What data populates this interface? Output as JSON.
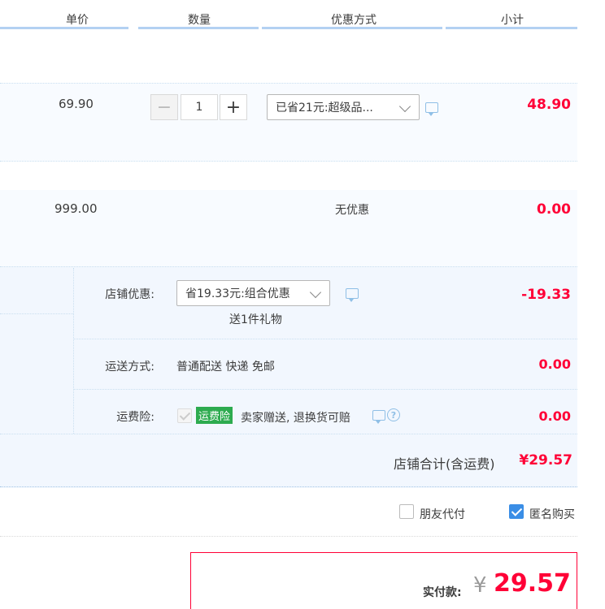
{
  "header": {
    "col_price": "单价",
    "col_qty": "数量",
    "col_promo": "优惠方式",
    "col_subtotal": "小计"
  },
  "item1": {
    "price": "69.90",
    "qty": "1",
    "promo_selected": "已省21元:超级品...",
    "subtotal": "48.90"
  },
  "item2": {
    "price": "999.00",
    "promo": "无优惠",
    "subtotal": "0.00"
  },
  "shop": {
    "discount_label": "店铺优惠:",
    "discount_selected": "省19.33元:组合优惠",
    "gift": "送1件礼物",
    "discount_value": "-19.33",
    "shipping_label": "运送方式:",
    "shipping_value": "普通配送 快递 免邮",
    "shipping_cost": "0.00",
    "insurance_label": "运费险:",
    "insurance_tag": "运费险",
    "insurance_text": "卖家赠送, 退换货可赔",
    "insurance_cost": "0.00",
    "total_label": "店铺合计(含运费)",
    "total_value": "¥29.57"
  },
  "options": {
    "friend_pay": "朋友代付",
    "anonymous": "匿名购买"
  },
  "payment": {
    "label": "实付款:",
    "currency": "¥",
    "amount": "29.57"
  },
  "colors": {
    "accent_red": "#ff0036",
    "row_bg": "#f8fbff",
    "header_line": "#b3d1f2",
    "tag_green": "#2dab4f",
    "checkbox_blue": "#3a8ee6"
  }
}
